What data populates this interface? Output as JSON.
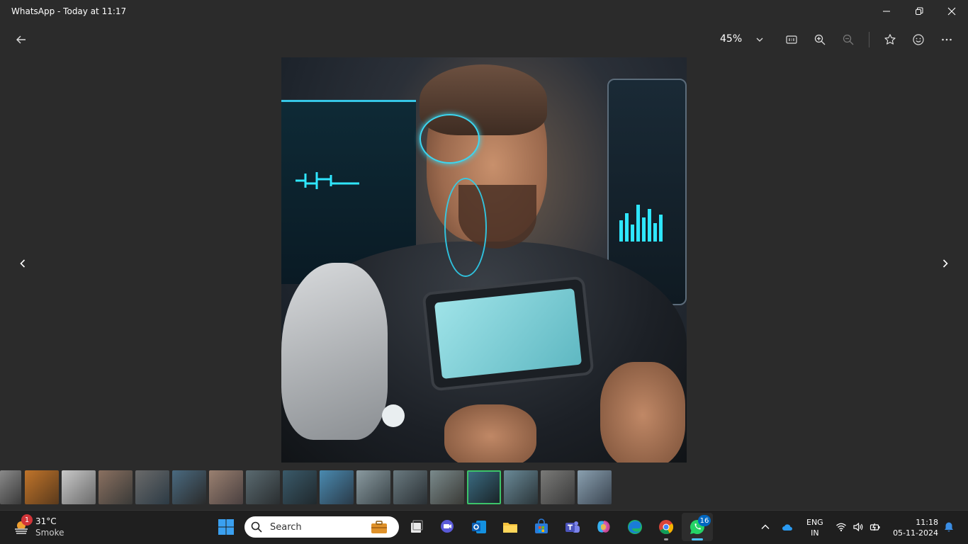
{
  "window": {
    "title": "WhatsApp - Today at 11:17"
  },
  "toolbar": {
    "zoom_level": "45%"
  },
  "filmstrip": {
    "selected_index": 13,
    "count": 17
  },
  "taskbar": {
    "weather": {
      "temperature": "31°C",
      "description": "Smoke",
      "alert_count": "1"
    },
    "search": {
      "placeholder": "Search"
    },
    "whatsapp_badge": "16",
    "language": {
      "line1": "ENG",
      "line2": "IN"
    },
    "clock": {
      "time": "11:18",
      "date": "05-11-2024"
    }
  },
  "colors": {
    "accent": "#3cc46a",
    "taskbar": "#1f1f1f",
    "background": "#2b2b2b",
    "badge_red": "#d13438",
    "badge_blue": "#0067c0"
  }
}
